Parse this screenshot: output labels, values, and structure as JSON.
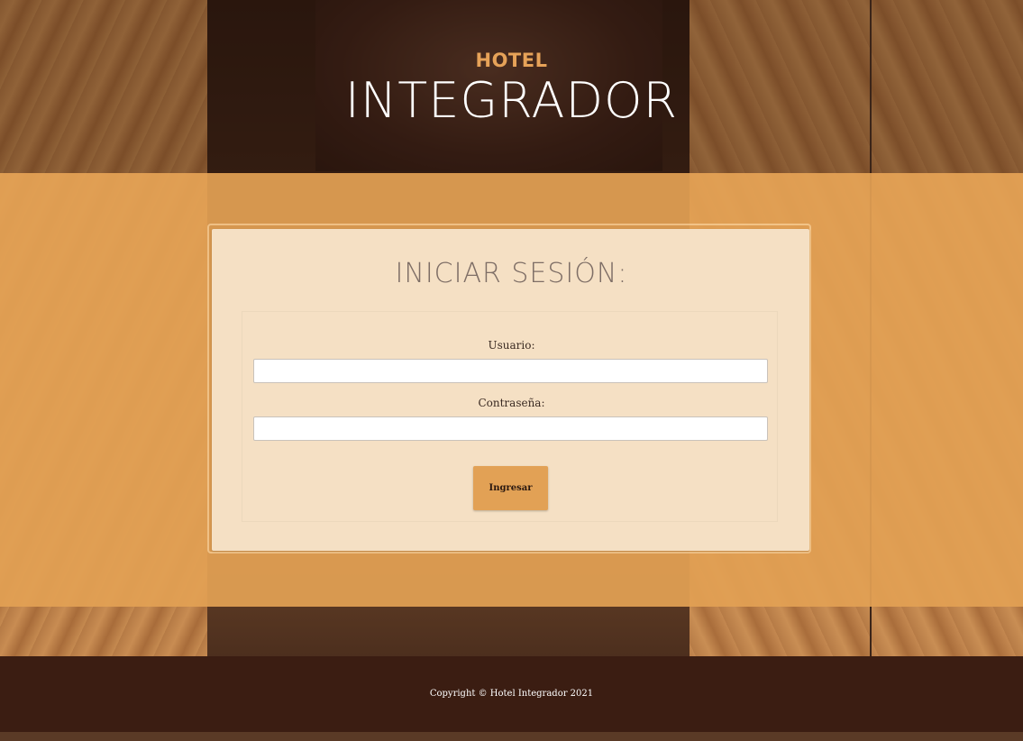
{
  "header": {
    "brand_small": "HOTEL",
    "brand_large": "INTEGRADOR"
  },
  "login": {
    "title": "INICIAR SESIÓN:",
    "username_label": "Usuario:",
    "username_value": "",
    "password_label": "Contraseña:",
    "password_value": "",
    "submit_label": "Ingresar"
  },
  "footer": {
    "copyright": "Copyright © Hotel Integrador 2021"
  },
  "colors": {
    "accent": "#e2a155",
    "brand_small": "#e6a258",
    "card_bg": "#f5e0c4",
    "footer_bg": "#3b1d12"
  }
}
